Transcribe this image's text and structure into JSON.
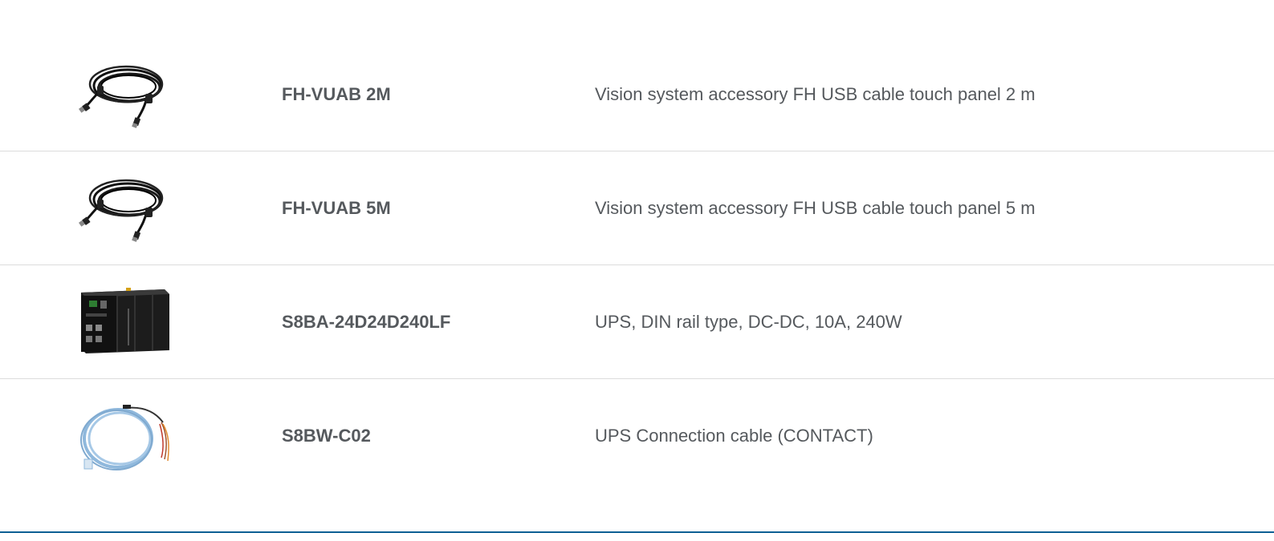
{
  "products": [
    {
      "image_icon": "usb-cable-black-icon",
      "model": "FH-VUAB 2M",
      "description": "Vision system accessory FH USB cable touch panel 2 m"
    },
    {
      "image_icon": "usb-cable-black-icon",
      "model": "FH-VUAB 5M",
      "description": "Vision system accessory FH USB cable touch panel 5 m"
    },
    {
      "image_icon": "ups-din-rail-unit-icon",
      "model": "S8BA-24D24D240LF",
      "description": "UPS, DIN rail type, DC-DC, 10A, 240W"
    },
    {
      "image_icon": "blue-connection-cable-icon",
      "model": "S8BW-C02",
      "description": "UPS Connection cable (CONTACT)"
    }
  ],
  "colors": {
    "text": "#55595d",
    "divider": "#dcdcdc",
    "accent_rule": "#0d5f94",
    "background": "#ffffff"
  }
}
